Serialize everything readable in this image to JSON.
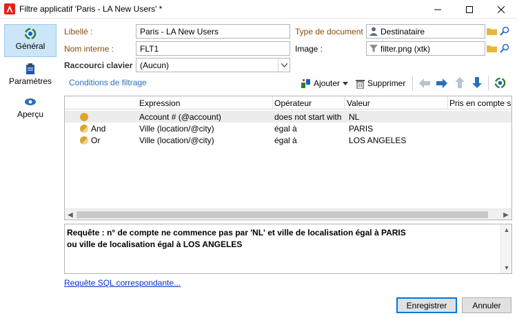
{
  "window": {
    "title": "Filtre applicatif 'Paris - LA New Users' *"
  },
  "nav": {
    "items": [
      {
        "label": "Général",
        "icon": "filter-icon"
      },
      {
        "label": "Paramètres",
        "icon": "clipboard-icon"
      },
      {
        "label": "Aperçu",
        "icon": "eye-icon"
      }
    ]
  },
  "form": {
    "libelle_label": "Libellé :",
    "libelle_value": "Paris - LA New Users",
    "nom_interne_label": "Nom interne :",
    "nom_interne_value": "FLT1",
    "raccourci_label": "Raccourci clavier :",
    "raccourci_value": "(Aucun)",
    "type_document_label": "Type de document :",
    "type_document_value": "Destinataire",
    "image_label": "Image :",
    "image_value": "filter.png (xtk)"
  },
  "filter": {
    "section_title": "Conditions de filtrage",
    "add_label": "Ajouter",
    "delete_label": "Supprimer",
    "columns": [
      "Expression",
      "Opérateur",
      "Valeur",
      "Pris en compte si"
    ],
    "rows": [
      {
        "conj": "",
        "expression": "Account # (@account)",
        "operator": "does not start with",
        "value": "NL"
      },
      {
        "conj": "And",
        "expression": "Ville (location/@city)",
        "operator": "égal à",
        "value": "PARIS"
      },
      {
        "conj": "Or",
        "expression": "Ville (location/@city)",
        "operator": "égal à",
        "value": "LOS ANGELES"
      }
    ]
  },
  "query": {
    "line1": "Requête : n° de compte ne commence pas par 'NL' et ville de localisation égal à PARIS",
    "line2": "ou ville de localisation égal à LOS ANGELES"
  },
  "sql_link": "Requête SQL correspondante...",
  "buttons": {
    "save": "Enregistrer",
    "cancel": "Annuler"
  },
  "colors": {
    "accent_blue": "#2a6ebb",
    "label_brown": "#8a4b08",
    "nav_active": "#cde6f7",
    "row_icon": "#d8a72e"
  }
}
